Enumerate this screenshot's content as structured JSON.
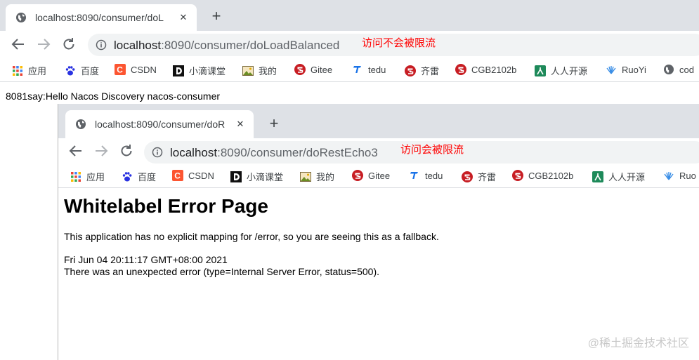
{
  "outer": {
    "tab_title": "localhost:8090/consumer/doL",
    "tab_close": "✕",
    "new_tab": "+",
    "url_host": "localhost",
    "url_rest": ":8090/consumer/doLoadBalanced",
    "annotation": "访问不会被限流",
    "page_text": "8081say:Hello Nacos Discovery nacos-consumer"
  },
  "inner": {
    "tab_title": "localhost:8090/consumer/doR",
    "tab_close": "✕",
    "new_tab": "+",
    "url_host": "localhost",
    "url_rest": ":8090/consumer/doRestEcho3",
    "annotation": "访问会被限流",
    "error_title": "Whitelabel Error Page",
    "error_message": "This application has no explicit mapping for /error, so you are seeing this as a fallback.",
    "error_timestamp": "Fri Jun 04 20:11:17 GMT+08:00 2021",
    "error_detail": "There was an unexpected error (type=Internal Server Error, status=500)."
  },
  "bookmarks": {
    "apps": "应用",
    "baidu": "百度",
    "csdn": "CSDN",
    "xiaodi": "小滴课堂",
    "mine": "我的",
    "gitee": "Gitee",
    "tedu": "tedu",
    "qilei": "齐雷",
    "cgb": "CGB2102b",
    "renren": "人人开源",
    "ruoyi": "RuoYi",
    "ruoyi_cut": "Ruo",
    "code_cut": "cod"
  },
  "watermark": "@稀土掘金技术社区",
  "colors": {
    "tabstrip": "#dee1e6",
    "omnibox": "#f1f3f4",
    "annotation": "#ff0000",
    "csdn": "#fc5531",
    "gitee": "#c71d23"
  }
}
